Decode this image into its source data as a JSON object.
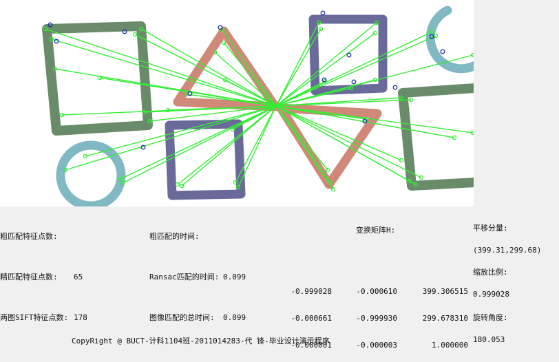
{
  "labels": {
    "coarse_points": "粗匹配特征点数:",
    "coarse_time": "粗匹配的时间:",
    "transform_matrix": "变换矩阵H:",
    "translation": "平移分量:",
    "fine_points": "精匹配特征点数:",
    "ransac_time": "Ransac匹配的时间:",
    "scale": "缩放比例:",
    "sift_points": "两图SIFT特征点数:",
    "total_time": "图像匹配的总时间:",
    "rotation": "旋转角度:"
  },
  "values": {
    "coarse_points": "",
    "coarse_time": "",
    "fine_points": "65",
    "ransac_time": "0.099",
    "sift_points": "178",
    "total_time": "0.099",
    "translation": "(399.31,299.68)",
    "scale": "0.999028",
    "rotation": "180.053"
  },
  "matrix": {
    "col1": [
      "-0.999028",
      "-0.000661",
      "-0.000001"
    ],
    "col2": [
      "-0.000610",
      "-0.999930",
      "-0.000003"
    ],
    "col3": [
      "399.306515",
      "299.678310",
      "1.000000"
    ]
  },
  "footer": "CopyRight @ BUCT-计科1104班-2011014283-代 锋-毕业设计演示程序",
  "colors": {
    "match_line": "#33ee33",
    "keypoint_blue": "#2233aa",
    "rect_green": "#6a8b6a",
    "triangle_salmon": "#d08878",
    "rect_purple": "#6a6a9a",
    "circle_teal": "#80b8c4"
  }
}
